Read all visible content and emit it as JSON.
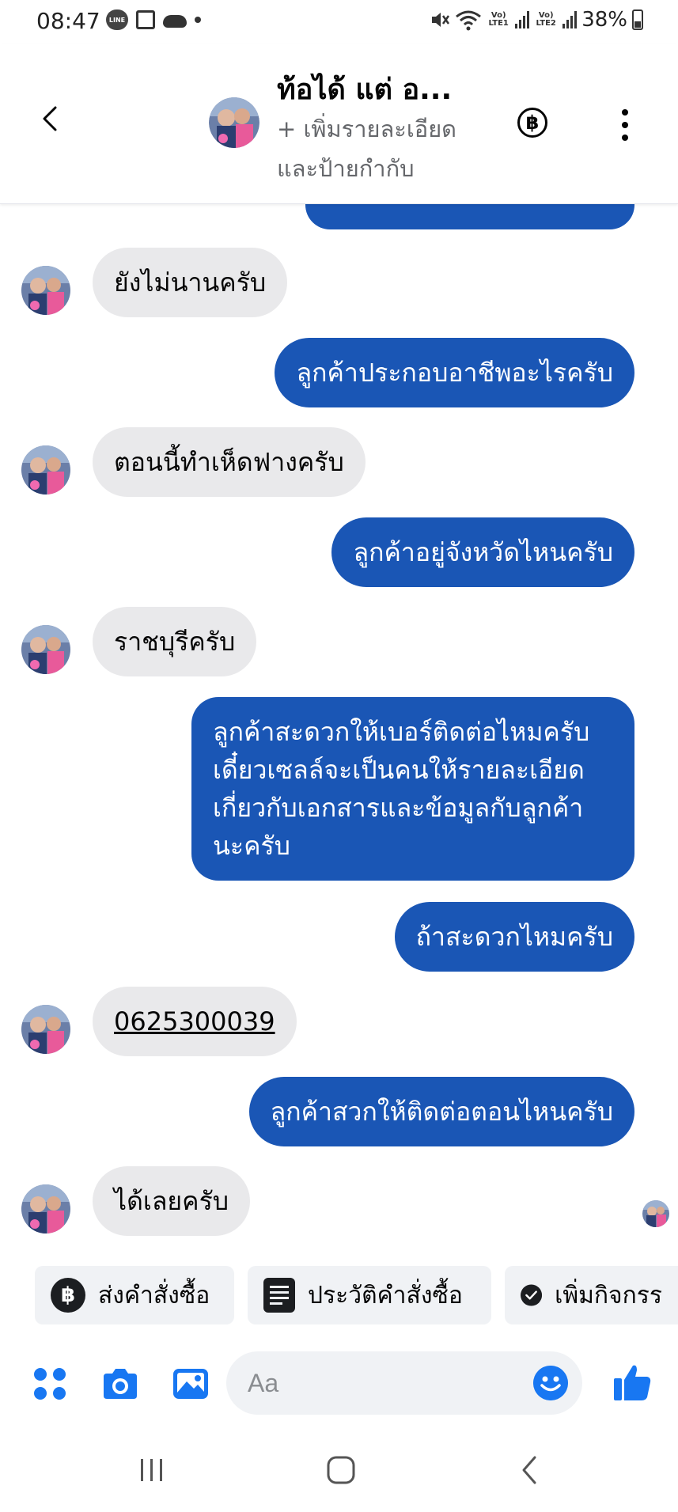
{
  "status_bar": {
    "time": "08:47",
    "sim1": "Vo) LTE1",
    "sim2": "Vo) LTE2",
    "battery": "38%"
  },
  "header": {
    "contact_name": "ท้อได้ แต่ อ...",
    "subtitle": "+ เพิ่มรายละเอียดและป้ายกำกับ",
    "baht_symbol": "฿"
  },
  "messages": [
    {
      "side": "in",
      "text": "ยังไม่นานครับ"
    },
    {
      "side": "out",
      "text": "ลูกค้าประกอบอาชีพอะไรครับ"
    },
    {
      "side": "in",
      "text": "ตอนนี้ทำเห็ดฟางครับ"
    },
    {
      "side": "out",
      "text": "ลูกค้าอยู่จังหวัดไหนครับ"
    },
    {
      "side": "in",
      "text": "ราชบุรีครับ"
    },
    {
      "side": "out",
      "text": "ลูกค้าสะดวกให้เบอร์ติดต่อไหมครับเดี๋ยวเซลล์จะเป็นคนให้รายละเอียดเกี่ยวกับเอกสารและข้อมูลกับลูกค้านะครับ"
    },
    {
      "side": "out",
      "text": "ถ้าสะดวกไหมครับ"
    },
    {
      "side": "in",
      "text": "0625300039"
    },
    {
      "side": "out",
      "text": "ลูกค้าสวกให้ติดต่อตอนไหนครับ"
    },
    {
      "side": "in",
      "text": "ได้เลยครับ"
    }
  ],
  "quick_actions": [
    {
      "label": "ส่งคำสั่งซื้อ",
      "icon": "baht-icon"
    },
    {
      "label": "ประวัติคำสั่งซื้อ",
      "icon": "order-history-icon"
    },
    {
      "label": "เพิ่มกิจกรร",
      "icon": "check-icon"
    }
  ],
  "composer": {
    "placeholder": "Aa"
  },
  "colors": {
    "outgoing_bubble": "#1a56b5",
    "incoming_bubble": "#e9e9eb",
    "accent": "#1877f2"
  }
}
